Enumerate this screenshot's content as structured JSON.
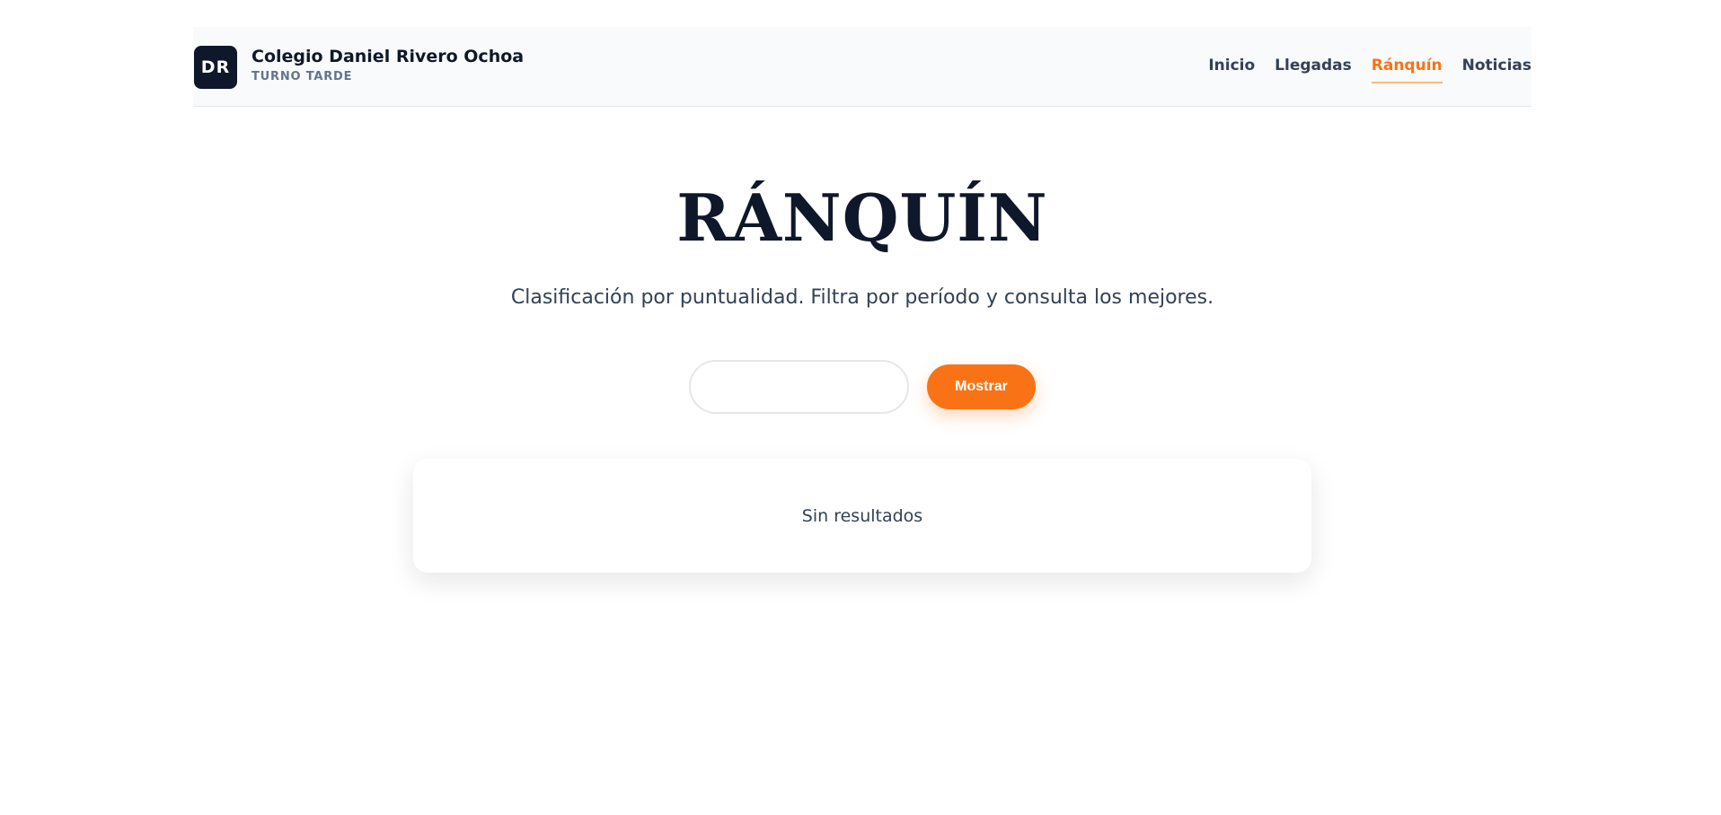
{
  "header": {
    "logo_initials": "DR",
    "school_name": "Colegio Daniel Rivero Ochoa",
    "shift": "TURNO TARDE",
    "nav": [
      {
        "label": "Inicio",
        "active": false
      },
      {
        "label": "Llegadas",
        "active": false
      },
      {
        "label": "Ránquín",
        "active": true
      },
      {
        "label": "Noticias",
        "active": false
      }
    ]
  },
  "main": {
    "title": "RÁNQUÍN",
    "subtitle": "Clasificación por puntualidad. Filtra por período y consulta los mejores.",
    "filter": {
      "period_value": "",
      "period_placeholder": "",
      "submit_label": "Mostrar"
    },
    "results": {
      "empty_message": "Sin resultados"
    }
  },
  "colors": {
    "accent": "#f97316",
    "dark": "#0f172a",
    "text": "#334155"
  }
}
